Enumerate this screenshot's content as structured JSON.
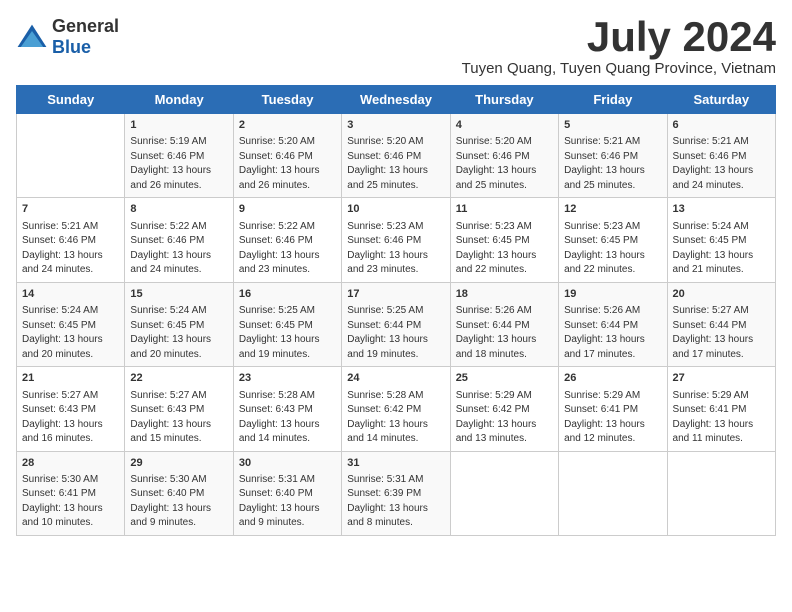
{
  "logo": {
    "general": "General",
    "blue": "Blue"
  },
  "header": {
    "month": "July 2024",
    "location": "Tuyen Quang, Tuyen Quang Province, Vietnam"
  },
  "days_of_week": [
    "Sunday",
    "Monday",
    "Tuesday",
    "Wednesday",
    "Thursday",
    "Friday",
    "Saturday"
  ],
  "weeks": [
    [
      {
        "day": "",
        "details": ""
      },
      {
        "day": "1",
        "details": "Sunrise: 5:19 AM\nSunset: 6:46 PM\nDaylight: 13 hours\nand 26 minutes."
      },
      {
        "day": "2",
        "details": "Sunrise: 5:20 AM\nSunset: 6:46 PM\nDaylight: 13 hours\nand 26 minutes."
      },
      {
        "day": "3",
        "details": "Sunrise: 5:20 AM\nSunset: 6:46 PM\nDaylight: 13 hours\nand 25 minutes."
      },
      {
        "day": "4",
        "details": "Sunrise: 5:20 AM\nSunset: 6:46 PM\nDaylight: 13 hours\nand 25 minutes."
      },
      {
        "day": "5",
        "details": "Sunrise: 5:21 AM\nSunset: 6:46 PM\nDaylight: 13 hours\nand 25 minutes."
      },
      {
        "day": "6",
        "details": "Sunrise: 5:21 AM\nSunset: 6:46 PM\nDaylight: 13 hours\nand 24 minutes."
      }
    ],
    [
      {
        "day": "7",
        "details": "Sunrise: 5:21 AM\nSunset: 6:46 PM\nDaylight: 13 hours\nand 24 minutes."
      },
      {
        "day": "8",
        "details": "Sunrise: 5:22 AM\nSunset: 6:46 PM\nDaylight: 13 hours\nand 24 minutes."
      },
      {
        "day": "9",
        "details": "Sunrise: 5:22 AM\nSunset: 6:46 PM\nDaylight: 13 hours\nand 23 minutes."
      },
      {
        "day": "10",
        "details": "Sunrise: 5:23 AM\nSunset: 6:46 PM\nDaylight: 13 hours\nand 23 minutes."
      },
      {
        "day": "11",
        "details": "Sunrise: 5:23 AM\nSunset: 6:45 PM\nDaylight: 13 hours\nand 22 minutes."
      },
      {
        "day": "12",
        "details": "Sunrise: 5:23 AM\nSunset: 6:45 PM\nDaylight: 13 hours\nand 22 minutes."
      },
      {
        "day": "13",
        "details": "Sunrise: 5:24 AM\nSunset: 6:45 PM\nDaylight: 13 hours\nand 21 minutes."
      }
    ],
    [
      {
        "day": "14",
        "details": "Sunrise: 5:24 AM\nSunset: 6:45 PM\nDaylight: 13 hours\nand 20 minutes."
      },
      {
        "day": "15",
        "details": "Sunrise: 5:24 AM\nSunset: 6:45 PM\nDaylight: 13 hours\nand 20 minutes."
      },
      {
        "day": "16",
        "details": "Sunrise: 5:25 AM\nSunset: 6:45 PM\nDaylight: 13 hours\nand 19 minutes."
      },
      {
        "day": "17",
        "details": "Sunrise: 5:25 AM\nSunset: 6:44 PM\nDaylight: 13 hours\nand 19 minutes."
      },
      {
        "day": "18",
        "details": "Sunrise: 5:26 AM\nSunset: 6:44 PM\nDaylight: 13 hours\nand 18 minutes."
      },
      {
        "day": "19",
        "details": "Sunrise: 5:26 AM\nSunset: 6:44 PM\nDaylight: 13 hours\nand 17 minutes."
      },
      {
        "day": "20",
        "details": "Sunrise: 5:27 AM\nSunset: 6:44 PM\nDaylight: 13 hours\nand 17 minutes."
      }
    ],
    [
      {
        "day": "21",
        "details": "Sunrise: 5:27 AM\nSunset: 6:43 PM\nDaylight: 13 hours\nand 16 minutes."
      },
      {
        "day": "22",
        "details": "Sunrise: 5:27 AM\nSunset: 6:43 PM\nDaylight: 13 hours\nand 15 minutes."
      },
      {
        "day": "23",
        "details": "Sunrise: 5:28 AM\nSunset: 6:43 PM\nDaylight: 13 hours\nand 14 minutes."
      },
      {
        "day": "24",
        "details": "Sunrise: 5:28 AM\nSunset: 6:42 PM\nDaylight: 13 hours\nand 14 minutes."
      },
      {
        "day": "25",
        "details": "Sunrise: 5:29 AM\nSunset: 6:42 PM\nDaylight: 13 hours\nand 13 minutes."
      },
      {
        "day": "26",
        "details": "Sunrise: 5:29 AM\nSunset: 6:41 PM\nDaylight: 13 hours\nand 12 minutes."
      },
      {
        "day": "27",
        "details": "Sunrise: 5:29 AM\nSunset: 6:41 PM\nDaylight: 13 hours\nand 11 minutes."
      }
    ],
    [
      {
        "day": "28",
        "details": "Sunrise: 5:30 AM\nSunset: 6:41 PM\nDaylight: 13 hours\nand 10 minutes."
      },
      {
        "day": "29",
        "details": "Sunrise: 5:30 AM\nSunset: 6:40 PM\nDaylight: 13 hours\nand 9 minutes."
      },
      {
        "day": "30",
        "details": "Sunrise: 5:31 AM\nSunset: 6:40 PM\nDaylight: 13 hours\nand 9 minutes."
      },
      {
        "day": "31",
        "details": "Sunrise: 5:31 AM\nSunset: 6:39 PM\nDaylight: 13 hours\nand 8 minutes."
      },
      {
        "day": "",
        "details": ""
      },
      {
        "day": "",
        "details": ""
      },
      {
        "day": "",
        "details": ""
      }
    ]
  ]
}
